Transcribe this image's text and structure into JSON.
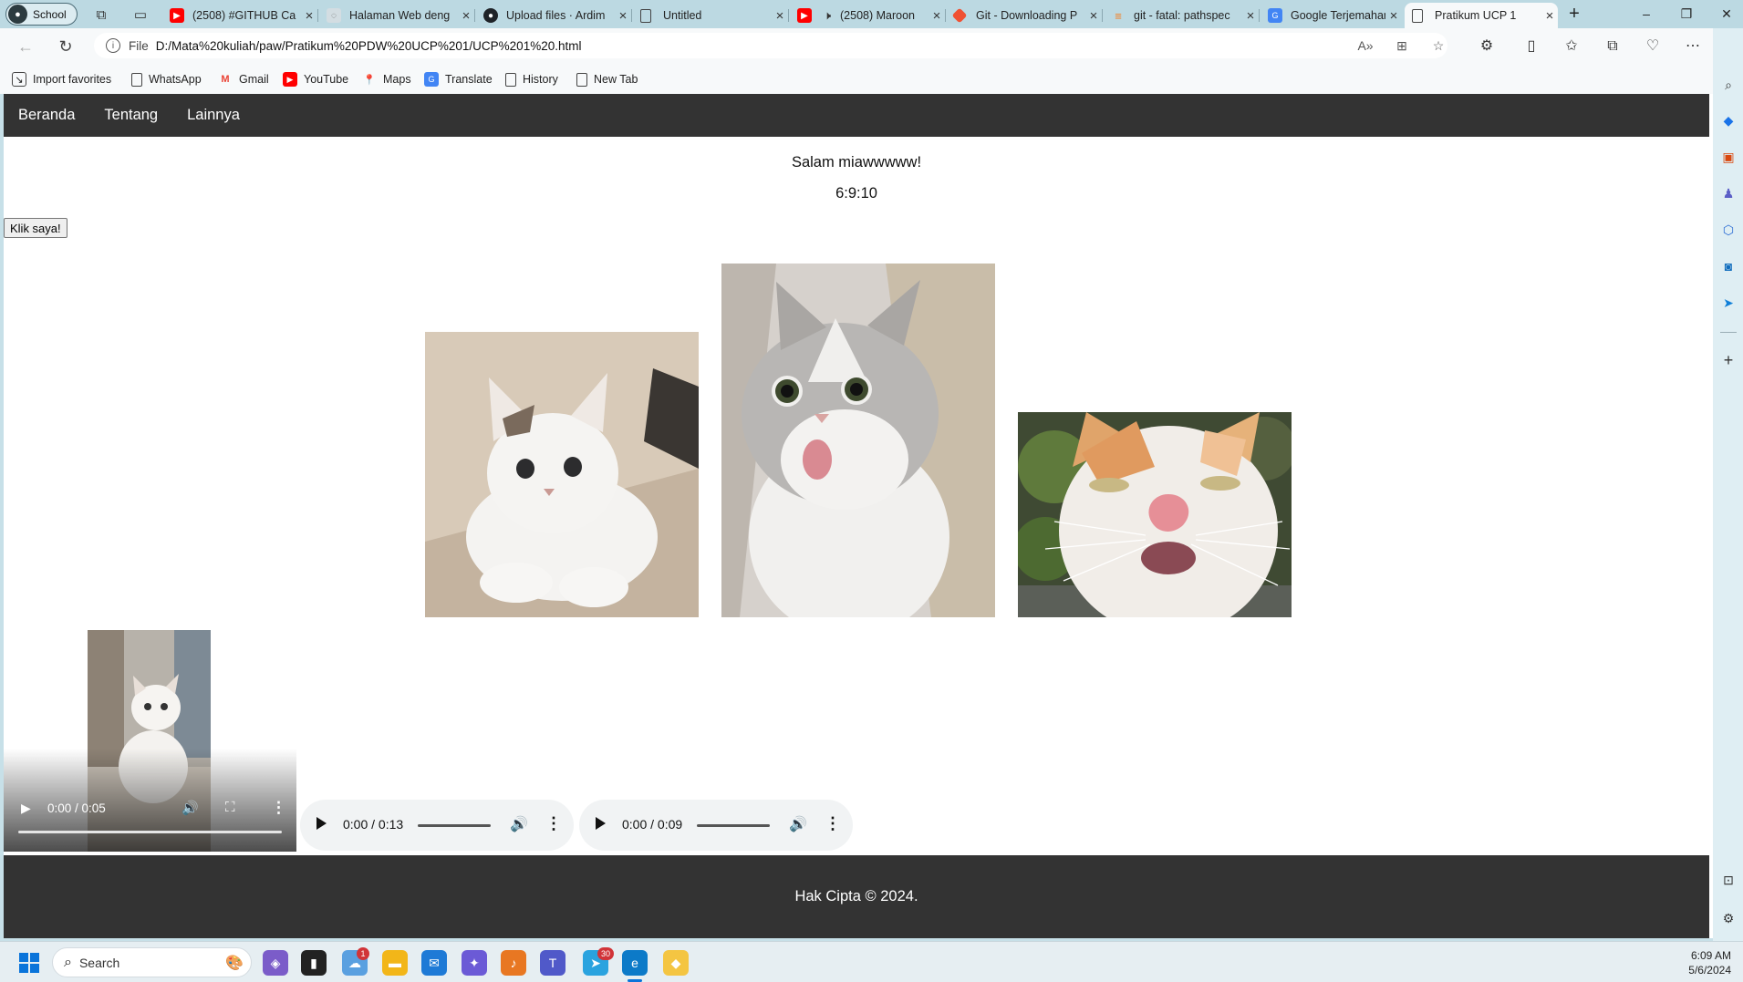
{
  "browser": {
    "profile_label": "School",
    "tabs": [
      {
        "title": "(2508) #GITHUB Ca",
        "favicon": "youtube-icon"
      },
      {
        "title": "Halaman Web deng",
        "favicon": "globe-icon"
      },
      {
        "title": "Upload files · Ardim",
        "favicon": "github-icon"
      },
      {
        "title": "Untitled",
        "favicon": "document-icon"
      },
      {
        "title": "(2508) Maroon",
        "favicon": "youtube-icon"
      },
      {
        "title": "Git - Downloading P",
        "favicon": "git-icon"
      },
      {
        "title": "git - fatal: pathspec",
        "favicon": "stackoverflow-icon"
      },
      {
        "title": "Google Terjemahan",
        "favicon": "translate-icon"
      },
      {
        "title": "Pratikum UCP 1",
        "favicon": "document-icon",
        "active": true
      }
    ],
    "address": {
      "scheme": "File",
      "url": "D:/Mata%20kuliah/paw/Pratikum%20PDW%20UCP%201/UCP%201%20.html"
    },
    "favorites": [
      {
        "label": "Import favorites",
        "icon": "import-icon"
      },
      {
        "label": "WhatsApp",
        "icon": "document-icon"
      },
      {
        "label": "Gmail",
        "icon": "gmail-icon"
      },
      {
        "label": "YouTube",
        "icon": "youtube-icon"
      },
      {
        "label": "Maps",
        "icon": "maps-icon"
      },
      {
        "label": "Translate",
        "icon": "translate-icon"
      },
      {
        "label": "History",
        "icon": "document-icon"
      },
      {
        "label": "New Tab",
        "icon": "document-icon"
      }
    ]
  },
  "page": {
    "nav": [
      "Beranda",
      "Tentang",
      "Lainnya"
    ],
    "greeting": "Salam miawwwww!",
    "clock": "6:9:10",
    "button_label": "Klik saya!",
    "images": [
      "kitten-white-image",
      "cat-surprised-image",
      "cat-calico-image"
    ],
    "video": {
      "time": "0:00 / 0:05"
    },
    "audio": [
      {
        "time": "0:00 / 0:13"
      },
      {
        "time": "0:00 / 0:09"
      }
    ],
    "footer": "Hak Cipta © 2024."
  },
  "taskbar": {
    "search_placeholder": "Search",
    "time": "6:09 AM",
    "date": "5/6/2024",
    "badges": {
      "notifications": "1",
      "telegram": "30"
    }
  },
  "colors": {
    "site_nav_bg": "#333333",
    "footer_bg": "#333333",
    "chrome_bg": "#bcd9e2",
    "start_blue": "#0a74da"
  }
}
